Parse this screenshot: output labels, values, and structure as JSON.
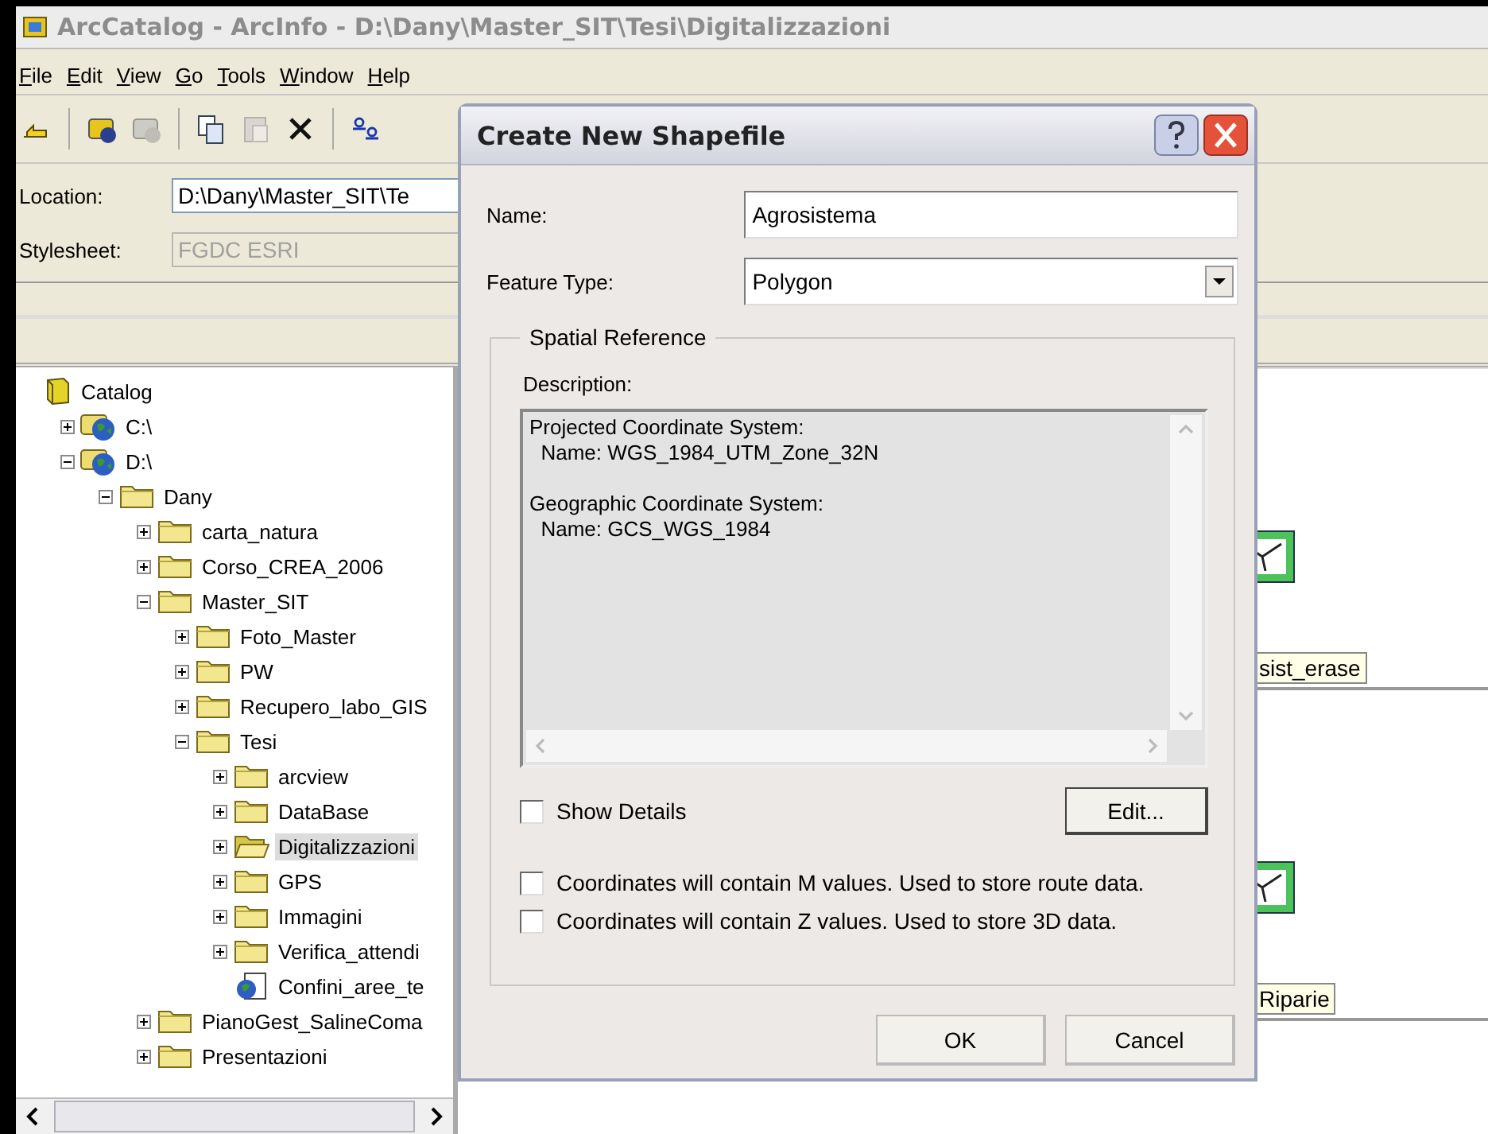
{
  "window": {
    "title": "ArcCatalog - ArcInfo - D:\\Dany\\Master_SIT\\Tesi\\Digitalizzazioni"
  },
  "menu": [
    "File",
    "Edit",
    "View",
    "Go",
    "Tools",
    "Window",
    "Help"
  ],
  "toolbar": [
    {
      "disabled": false
    },
    {
      "disabled": false
    },
    {
      "disabled": true
    },
    {
      "disabled": false
    },
    {
      "disabled": true
    },
    {
      "disabled": false
    },
    {
      "disabled": false
    }
  ],
  "location": {
    "label": "Location:",
    "value": "D:\\Dany\\Master_SIT\\Te"
  },
  "stylesheet": {
    "label": "Stylesheet:",
    "value": "FGDC ESRI",
    "disabled": true
  },
  "tree": [
    {
      "label": "Catalog",
      "kind": "catalog",
      "selected": false,
      "children": [
        {
          "label": "C:\\",
          "kind": "drive",
          "expanded": false,
          "selected": false
        },
        {
          "label": "D:\\",
          "kind": "drive",
          "expanded": true,
          "selected": false,
          "children": [
            {
              "label": "Dany",
              "kind": "folder",
              "expanded": true,
              "selected": false,
              "children": [
                {
                  "label": "carta_natura",
                  "kind": "folder",
                  "expanded": false,
                  "selected": false
                },
                {
                  "label": "Corso_CREA_2006",
                  "kind": "folder",
                  "expanded": false,
                  "selected": false
                },
                {
                  "label": "Master_SIT",
                  "kind": "folder",
                  "expanded": true,
                  "selected": false,
                  "children": [
                    {
                      "label": "Foto_Master",
                      "kind": "folder",
                      "expanded": false,
                      "selected": false
                    },
                    {
                      "label": "PW",
                      "kind": "folder",
                      "expanded": false,
                      "selected": false
                    },
                    {
                      "label": "Recupero_labo_GIS",
                      "kind": "folder",
                      "expanded": false,
                      "selected": false
                    },
                    {
                      "label": "Tesi",
                      "kind": "folder",
                      "expanded": true,
                      "selected": false,
                      "children": [
                        {
                          "label": "arcview",
                          "kind": "folder",
                          "expanded": false,
                          "selected": false
                        },
                        {
                          "label": "DataBase",
                          "kind": "folder",
                          "expanded": false,
                          "selected": false
                        },
                        {
                          "label": "Digitalizzazioni",
                          "kind": "folder",
                          "expanded": false,
                          "selected": true
                        },
                        {
                          "label": "GPS",
                          "kind": "folder",
                          "expanded": false,
                          "selected": false
                        },
                        {
                          "label": "Immagini",
                          "kind": "folder",
                          "expanded": false,
                          "selected": false
                        },
                        {
                          "label": "Verifica_attendi",
                          "kind": "folder",
                          "expanded": false,
                          "selected": false
                        },
                        {
                          "label": "Confini_aree_te",
                          "kind": "layer",
                          "selected": false
                        }
                      ]
                    }
                  ]
                },
                {
                  "label": "PianoGest_SalineComa",
                  "kind": "folder",
                  "expanded": false,
                  "selected": false
                },
                {
                  "label": "Presentazioni",
                  "kind": "folder",
                  "expanded": false,
                  "selected": false
                }
              ]
            }
          ]
        }
      ]
    }
  ],
  "contents": [
    {
      "label": "sist_erase"
    },
    {
      "label": "Riparie"
    }
  ],
  "dialog": {
    "title": "Create New Shapefile",
    "name": {
      "label": "Name:",
      "value": "Agrosistema"
    },
    "feature_type": {
      "label": "Feature Type:",
      "value": "Polygon"
    },
    "group": "Spatial Reference",
    "description_label": "Description:",
    "description": [
      {
        "heading": "Projected Coordinate System:",
        "name": "  Name: WGS_1984_UTM_Zone_32N"
      },
      {
        "heading": "Geographic Coordinate System:",
        "name": "  Name: GCS_WGS_1984"
      }
    ],
    "show_details": {
      "label": "Show Details",
      "checked": false
    },
    "edit_button": "Edit...",
    "options": [
      {
        "label": "Coordinates will contain M values. Used to store route data.",
        "checked": false
      },
      {
        "label": "Coordinates will contain Z values. Used to store 3D data.",
        "checked": false
      }
    ],
    "buttons": [
      "OK",
      "Cancel"
    ]
  }
}
